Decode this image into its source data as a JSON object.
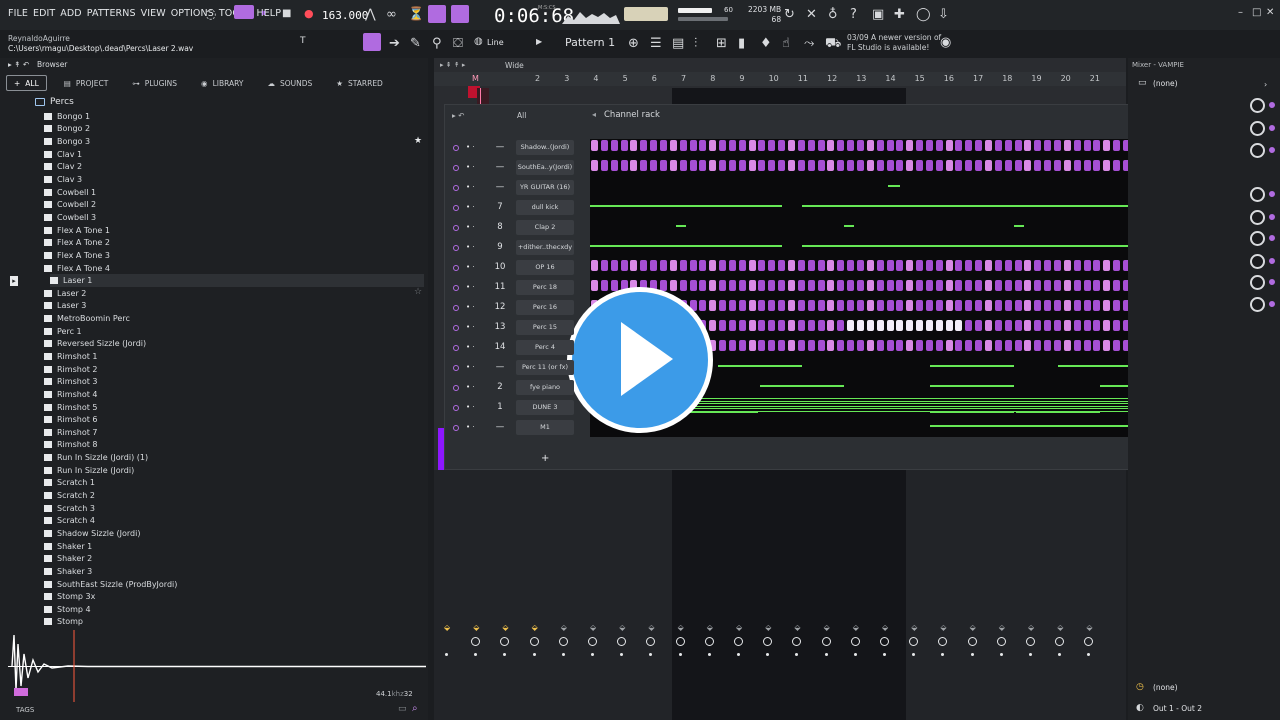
{
  "menu": [
    "FILE",
    "EDIT",
    "ADD",
    "PATTERNS",
    "VIEW",
    "OPTIONS",
    "TOOLS",
    "HELP"
  ],
  "transport": {
    "tempo": "163.000",
    "time": "0:06:68",
    "time_unit": "M:S:CS"
  },
  "monitor": {
    "volume_value": "60",
    "mem": "2203 MB",
    "cpu": "68"
  },
  "hint": {
    "user": "ReynaldoAguirre",
    "path": "C:\\Users\\rmagu\\Desktop\\.dead\\Percs\\Laser 2.wav"
  },
  "toolbar2": {
    "snap": "Line",
    "pattern": "Pattern 1"
  },
  "news": {
    "line1": "03/09  A newer version of",
    "line2": "FL Studio is available!"
  },
  "browser": {
    "title": "Browser",
    "tabs": [
      "ALL",
      "PROJECT",
      "PLUGINS",
      "LIBRARY",
      "SOUNDS",
      "STARRED"
    ],
    "folder": "Percs",
    "files": [
      "Bongo 1",
      "Bongo 2",
      "Bongo 3",
      "Clav 1",
      "Clav 2",
      "Clav 3",
      "Cowbell 1",
      "Cowbell 2",
      "Cowbell 3",
      "Flex A Tone 1",
      "Flex A Tone 2",
      "Flex A Tone 3",
      "Flex A Tone 4",
      "Laser 1",
      "Laser 2",
      "Laser 3",
      "MetroBoomin Perc",
      "Perc 1",
      "Reversed Sizzle (Jordi)",
      "Rimshot 1",
      "Rimshot 2",
      "Rimshot 3",
      "Rimshot 4",
      "Rimshot 5",
      "Rimshot 6",
      "Rimshot 7",
      "Rimshot 8",
      "Run In Sizzle (Jordi) (1)",
      "Run In Sizzle (Jordi)",
      "Scratch 1",
      "Scratch 2",
      "Scratch 3",
      "Scratch 4",
      "Shadow Sizzle (Jordi)",
      "Shaker 1",
      "Shaker 2",
      "Shaker 3",
      "SouthEast Sizzle (ProdByJordi)",
      "Stomp 3x",
      "Stomp 4",
      "Stomp"
    ],
    "selected": "Laser 1",
    "sample_rate": "44.1",
    "bit_depth": "32",
    "tags_label": "TAGS"
  },
  "playlist": {
    "view_label": "Wide",
    "ruler": [
      "2",
      "3",
      "4",
      "5",
      "6",
      "7",
      "8",
      "9",
      "10",
      "11",
      "12",
      "13",
      "14",
      "15",
      "16",
      "17",
      "18",
      "19",
      "20",
      "21"
    ]
  },
  "rack": {
    "title": "Channel rack",
    "filter": "All",
    "channels": [
      {
        "num": "—",
        "name": "Shadow..(Jordi)",
        "kind": "steps"
      },
      {
        "num": "—",
        "name": "SouthEa..y(Jordi)",
        "kind": "steps"
      },
      {
        "num": "—",
        "name": "YR GUITAR (16)",
        "kind": "notes"
      },
      {
        "num": "7",
        "name": "dull kick",
        "kind": "notes"
      },
      {
        "num": "8",
        "name": "Clap 2",
        "kind": "notes"
      },
      {
        "num": "9",
        "name": "+dither..thecxdy",
        "kind": "notes"
      },
      {
        "num": "10",
        "name": "OP 16",
        "kind": "steps"
      },
      {
        "num": "11",
        "name": "Perc 18",
        "kind": "steps"
      },
      {
        "num": "12",
        "name": "Perc 16",
        "kind": "steps"
      },
      {
        "num": "13",
        "name": "Perc 15",
        "kind": "steps"
      },
      {
        "num": "14",
        "name": "Perc 4",
        "kind": "steps"
      },
      {
        "num": "—",
        "name": "Perc 11 (or fx)",
        "kind": "notes"
      },
      {
        "num": "2",
        "name": "fye piano",
        "kind": "notes"
      },
      {
        "num": "1",
        "name": "DUNE 3",
        "kind": "notes"
      },
      {
        "num": "—",
        "name": "M1",
        "kind": "notes"
      }
    ]
  },
  "mixer": {
    "title": "Mixer - VAMPIE",
    "insert_none": "(none)",
    "slot_none": "(none)",
    "output": "Out 1 - Out 2"
  },
  "colors": {
    "step_on": "#d98ae6",
    "step_off": "#a64fd4",
    "note": "#66e856",
    "accent": "#9b3dff",
    "play": "#3c9be8"
  },
  "icons": [
    "play-icon",
    "pause-icon",
    "stop-icon",
    "record-icon",
    "search-icon",
    "star-icon",
    "folder-icon"
  ]
}
